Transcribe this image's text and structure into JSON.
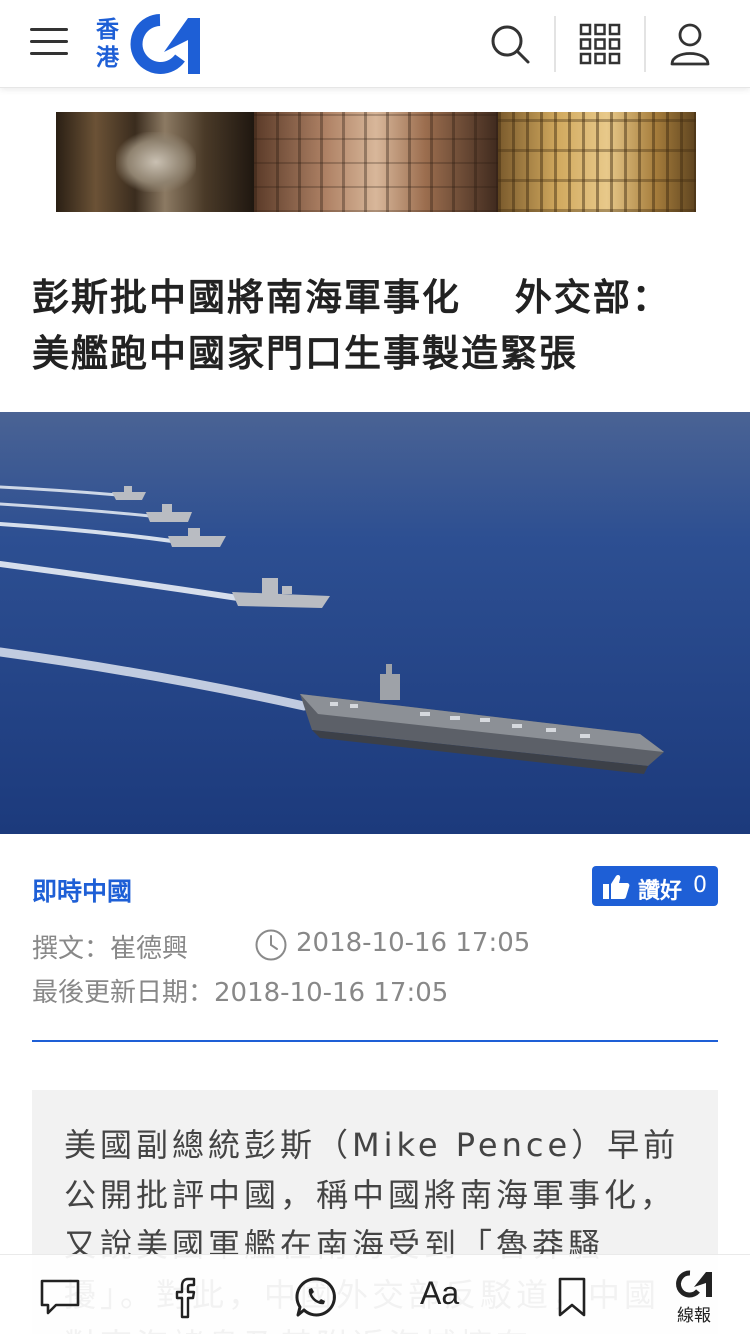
{
  "header": {
    "logo_text": "香港",
    "logo_brand": "01",
    "icons": [
      "menu-icon",
      "search-icon",
      "grid-icon",
      "user-icon"
    ]
  },
  "article": {
    "title_line1": "彭斯批中國將南海軍事化　 外交部：",
    "title_line2": "美艦跑中國家門口生事製造緊張",
    "category": "即時中國",
    "like_label": "讚好",
    "like_count": "0",
    "author": "撰文：崔德興",
    "published": "2018-10-16 17:05",
    "last_updated": "最後更新日期：2018-10-16 17:05",
    "lead": "美國副總統彭斯（Mike Pence）早前公開批評中國，稱中國將南海軍事化，又說美國軍艦在南海受到「魯莽騷擾」。對此，中國外交部反駁道，中國對南海諸島及其附近海域擁有"
  },
  "toolbar": {
    "font_label": "Aa",
    "live_label": "線報"
  },
  "colors": {
    "brand": "#1e5fd6",
    "text": "#222222",
    "meta": "#888888",
    "lead_bg": "#f2f2f2"
  }
}
